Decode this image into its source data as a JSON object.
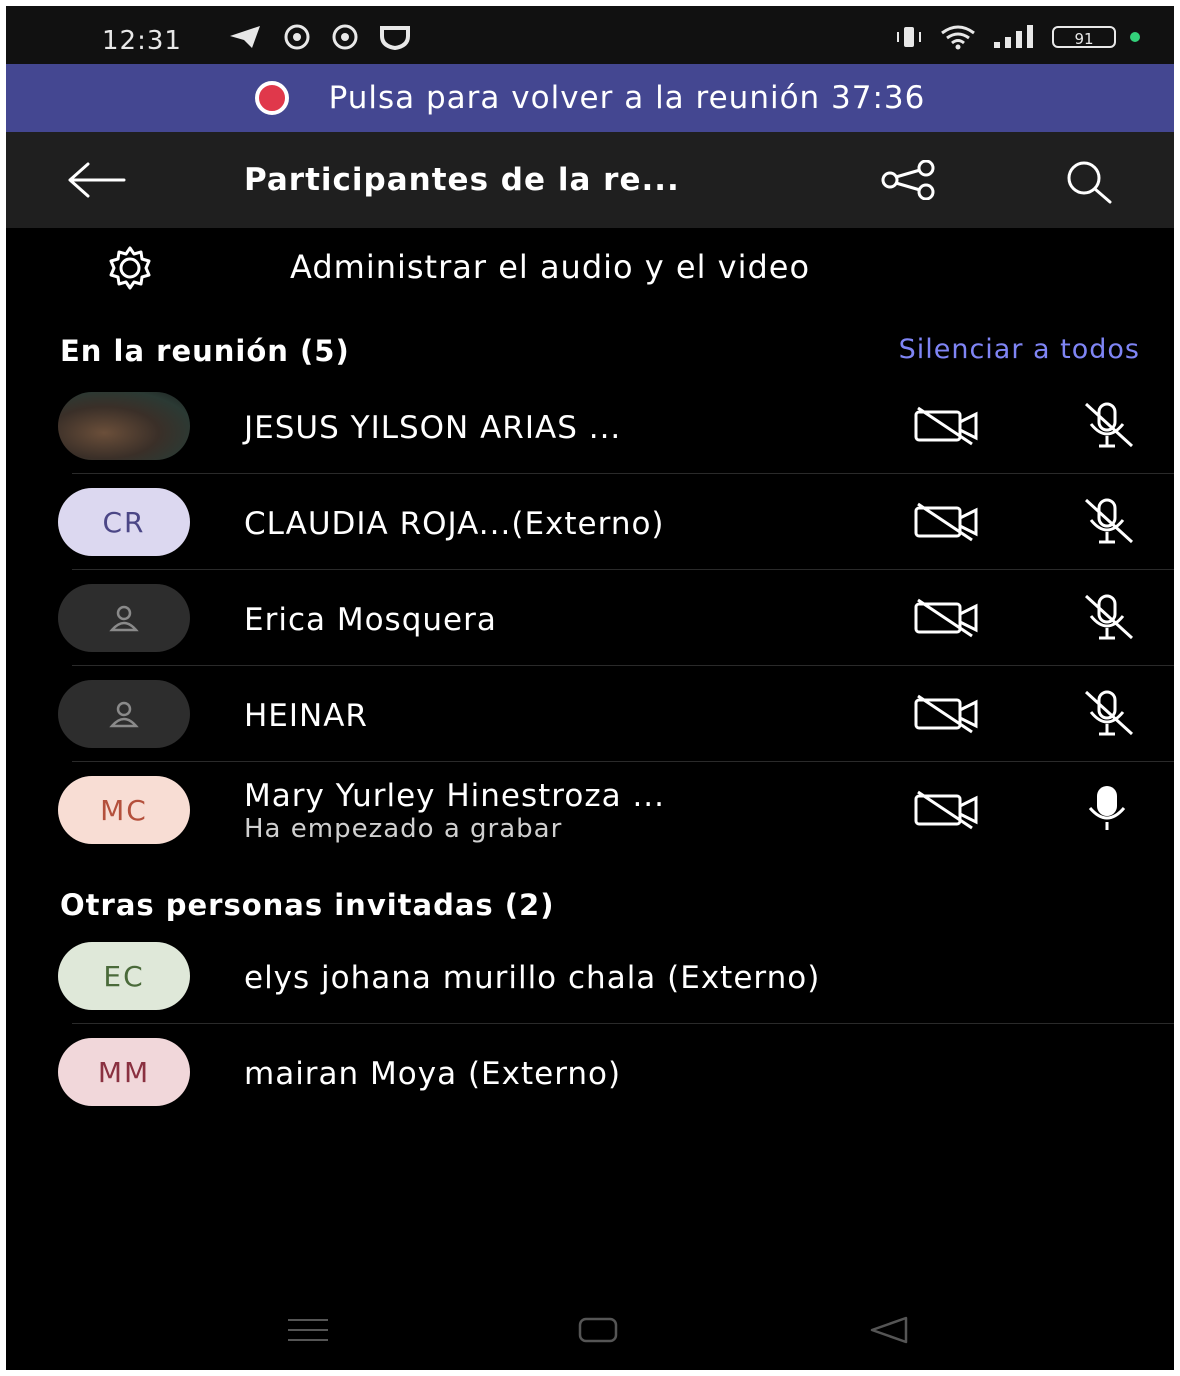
{
  "status_bar": {
    "time": "12:31",
    "battery": "91",
    "icons": [
      "telegram-icon",
      "chrome-icon",
      "chrome-icon",
      "shield-icon",
      "vibrate-icon",
      "wifi-icon",
      "signal-icon",
      "battery-icon"
    ]
  },
  "banner": {
    "text": "Pulsa para volver a la reunión 37:36",
    "color": "#444791",
    "record_color": "#e0384b"
  },
  "header": {
    "title": "Participantes de la re...",
    "icons": [
      "back-arrow-icon",
      "share-icon",
      "search-icon"
    ]
  },
  "manage": {
    "label": "Administrar el audio y el video",
    "icon": "gear-icon"
  },
  "in_meeting": {
    "heading": "En la reunión (5)",
    "action": "Silenciar a todos",
    "accent": "#7f85f5",
    "participants": [
      {
        "initials": "",
        "name": "JESUS YILSON  ARIAS ...",
        "subtext": "",
        "camera": "off",
        "mic": "muted"
      },
      {
        "initials": "CR",
        "name": "CLAUDIA ROJA...(Externo)",
        "subtext": "",
        "camera": "off",
        "mic": "muted",
        "avatar_bg": "#dcd8f0",
        "avatar_fg": "#4b4686"
      },
      {
        "initials": "",
        "name": "Erica Mosquera",
        "subtext": "",
        "camera": "off",
        "mic": "muted"
      },
      {
        "initials": "",
        "name": "HEINAR",
        "subtext": "",
        "camera": "off",
        "mic": "muted"
      },
      {
        "initials": "MC",
        "name": "Mary Yurley Hinestroza ...",
        "subtext": "Ha empezado a grabar",
        "camera": "off",
        "mic": "on",
        "avatar_bg": "#f8ddd4",
        "avatar_fg": "#b4503c"
      }
    ]
  },
  "invited": {
    "heading": "Otras personas invitadas (2)",
    "people": [
      {
        "initials": "EC",
        "name": "elys johana murillo chala (Externo)",
        "avatar_bg": "#dfe8d9",
        "avatar_fg": "#4a6a3a"
      },
      {
        "initials": "MM",
        "name": "mairan Moya (Externo)",
        "avatar_bg": "#f1d7da",
        "avatar_fg": "#8a3040"
      }
    ]
  },
  "nav_bar": {
    "icons": [
      "recent-apps-icon",
      "home-icon",
      "back-triangle-icon"
    ]
  }
}
